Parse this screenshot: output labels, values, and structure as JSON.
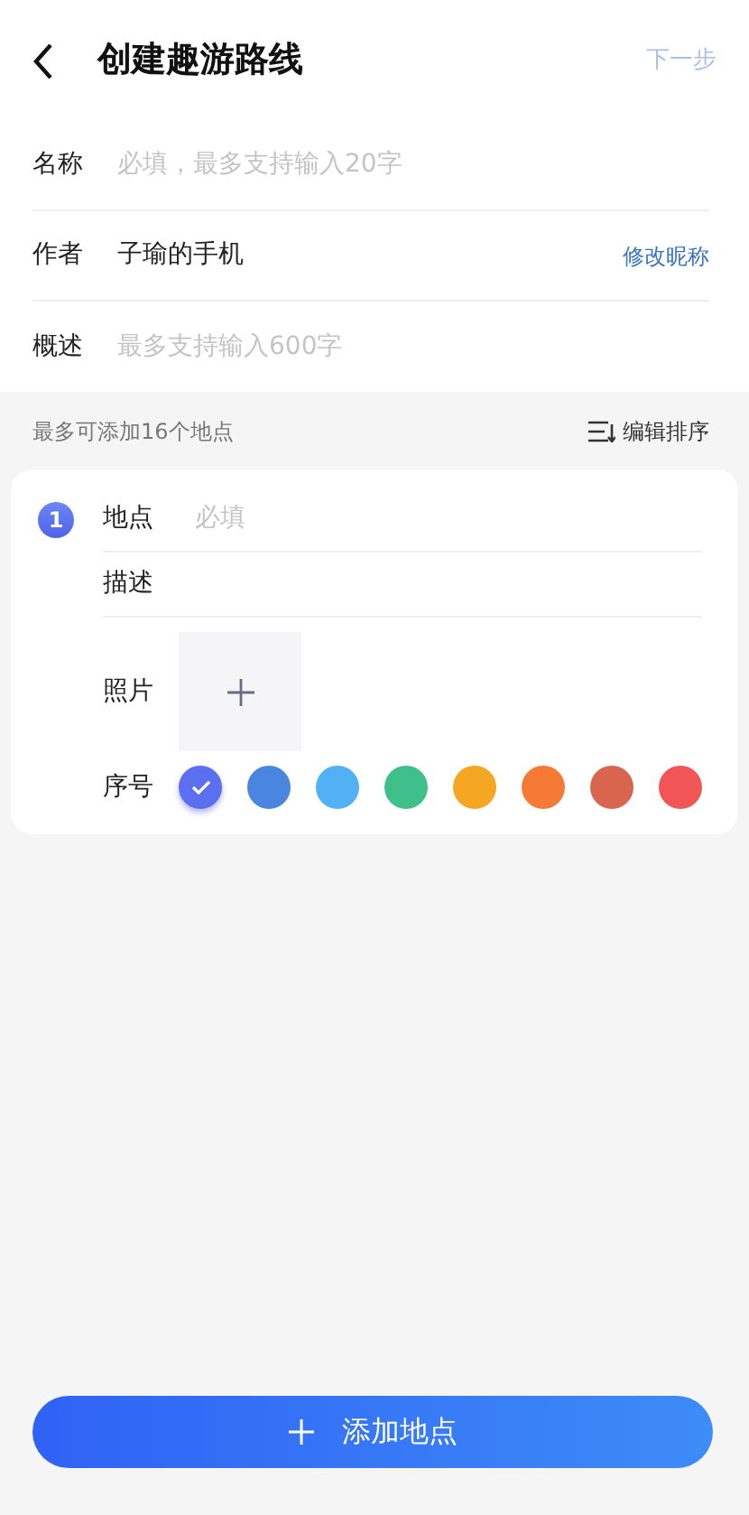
{
  "header": {
    "title": "创建趣游路线",
    "next": "下一步"
  },
  "form": [
    {
      "label": "名称",
      "placeholder": "必填，最多支持输入20字"
    },
    {
      "label": "作者",
      "value": "子瑜的手机",
      "action": "修改昵称"
    },
    {
      "label": "概述",
      "placeholder": "最多支持输入600字"
    }
  ],
  "hint": "最多可添加16个地点",
  "sort_action": "编辑排序",
  "place": {
    "number": "1",
    "place_label": "地点",
    "place_placeholder": "必填",
    "desc_label": "描述",
    "photo_label": "照片",
    "order_label": "序号",
    "colors": [
      {
        "color": "#5b6ff0",
        "selected": true
      },
      {
        "color": "#4a86e0",
        "selected": false
      },
      {
        "color": "#52b0f5",
        "selected": false
      },
      {
        "color": "#3fbf8a",
        "selected": false
      },
      {
        "color": "#f5a623",
        "selected": false
      },
      {
        "color": "#f57a35",
        "selected": false
      },
      {
        "color": "#d9654e",
        "selected": false
      },
      {
        "color": "#f25555",
        "selected": false
      }
    ]
  },
  "add_button": "添加地点"
}
